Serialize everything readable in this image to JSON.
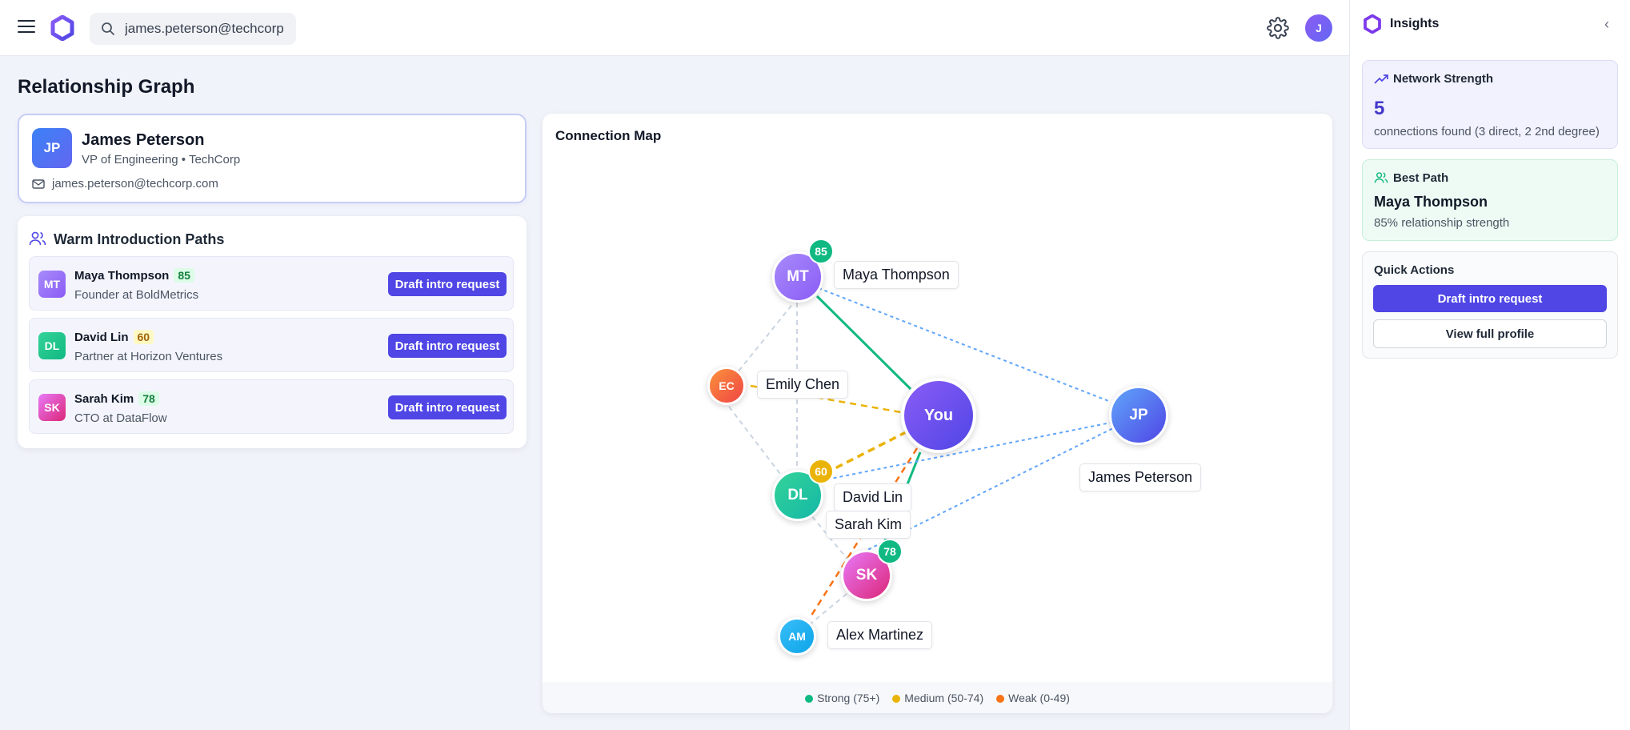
{
  "topbar": {
    "search_value": "james.peterson@techcorp",
    "user_initial": "J"
  },
  "page": {
    "title": "Relationship Graph"
  },
  "profile": {
    "initials": "JP",
    "name": "James Peterson",
    "role": "VP of Engineering • TechCorp",
    "email": "james.peterson@techcorp.com"
  },
  "paths": {
    "title": "Warm Introduction Paths",
    "items": [
      {
        "initials": "MT",
        "name": "Maya Thompson",
        "score": "85",
        "role": "Founder at BoldMetrics",
        "button": "Draft intro request"
      },
      {
        "initials": "DL",
        "name": "David Lin",
        "score": "60",
        "role": "Partner at Horizon Ventures",
        "button": "Draft intro request"
      },
      {
        "initials": "SK",
        "name": "Sarah Kim",
        "score": "78",
        "role": "CTO at DataFlow",
        "button": "Draft intro request"
      }
    ]
  },
  "map": {
    "title": "Connection Map",
    "nodes": {
      "you": {
        "initials": "You"
      },
      "mt": {
        "initials": "MT",
        "label": "Maya Thompson",
        "score": "85"
      },
      "ec": {
        "initials": "EC",
        "label": "Emily Chen"
      },
      "dl": {
        "initials": "DL",
        "label": "David Lin",
        "score": "60"
      },
      "sk": {
        "initials": "SK",
        "label": "Sarah Kim",
        "score": "78"
      },
      "am": {
        "initials": "AM",
        "label": "Alex Martinez"
      },
      "jp": {
        "initials": "JP",
        "label": "James Peterson"
      }
    },
    "legend": [
      {
        "label": "Strong (75+)",
        "color": "#10b981"
      },
      {
        "label": "Medium (50-74)",
        "color": "#eab308"
      },
      {
        "label": "Weak (0-49)",
        "color": "#f97316"
      }
    ]
  },
  "insights": {
    "title": "Insights",
    "network": {
      "label": "Network Strength",
      "count": "5",
      "sub": "connections found (3 direct, 2 2nd degree)"
    },
    "best": {
      "label": "Best Path",
      "name": "Maya Thompson",
      "sub": "85% relationship strength"
    },
    "actions": {
      "label": "Quick Actions",
      "primary": "Draft intro request",
      "secondary": "View full profile"
    }
  },
  "colors": {
    "accent": "#4f46e5",
    "strong": "#10b981",
    "medium": "#eab308",
    "weak": "#f97316",
    "second_degree": "#60a5fa"
  }
}
